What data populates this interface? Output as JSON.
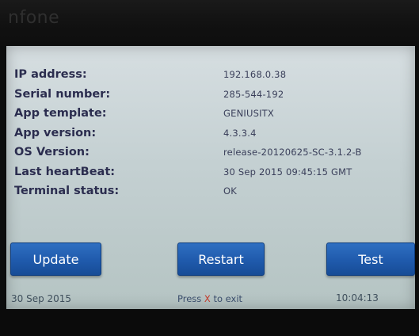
{
  "header": {
    "logo_text": "nfone"
  },
  "info": {
    "rows": [
      {
        "label": "IP address:",
        "value": "192.168.0.38"
      },
      {
        "label": "Serial number:",
        "value": "285-544-192"
      },
      {
        "label": "App template:",
        "value": "GENIUSITX"
      },
      {
        "label": "App version:",
        "value": "4.3.3.4"
      },
      {
        "label": "OS Version:",
        "value": "release-20120625-SC-3.1.2-B"
      },
      {
        "label": "Last heartBeat:",
        "value": "30 Sep 2015 09:45:15 GMT"
      },
      {
        "label": "Terminal status:",
        "value": "OK"
      }
    ]
  },
  "buttons": {
    "update_label": "Update",
    "restart_label": "Restart",
    "test_label": "Test"
  },
  "footer": {
    "date": "30 Sep 2015",
    "exit_prefix": "Press ",
    "exit_key": "X",
    "exit_suffix": " to exit",
    "time": "10:04:13"
  },
  "colors": {
    "screen_background": "#c9d4d6",
    "label_text": "#2b2d4f",
    "button_blue": "#1f5aac",
    "exit_key_red": "#c23a2a"
  }
}
